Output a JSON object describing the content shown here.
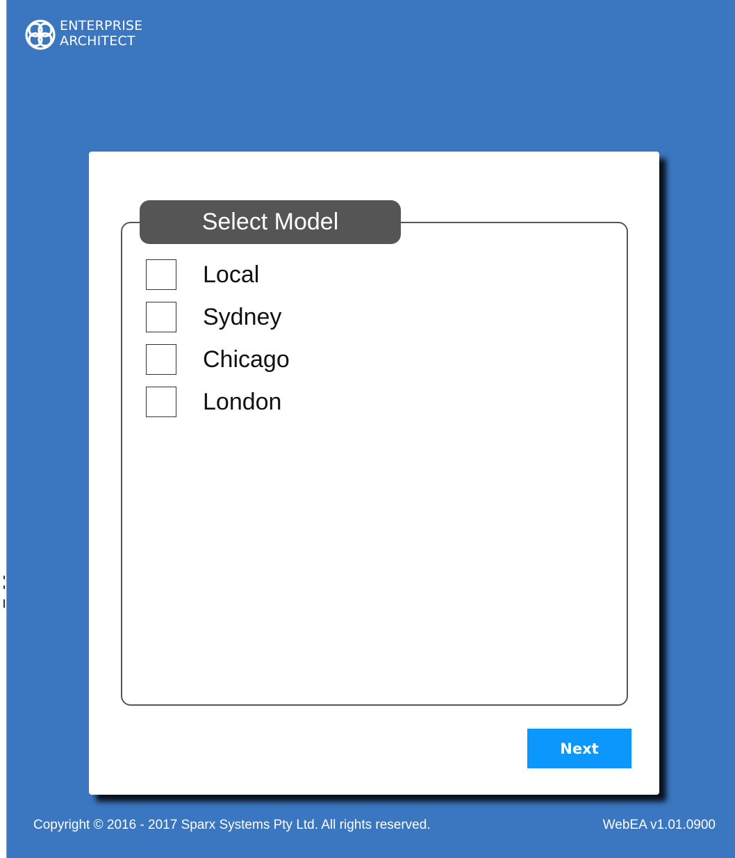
{
  "brand": {
    "line1": "ENTERPRISE",
    "line2": "ARCHITECT",
    "icon": "enterprise-architect-logo-icon"
  },
  "panel": {
    "legend": "Select Model",
    "models": [
      {
        "label": "Local",
        "checked": false
      },
      {
        "label": "Sydney",
        "checked": false
      },
      {
        "label": "Chicago",
        "checked": false
      },
      {
        "label": "London",
        "checked": false
      }
    ],
    "next_label": "Next"
  },
  "footer": {
    "copyright": "Copyright © 2016 - 2017 Sparx Systems Pty Ltd. All rights reserved.",
    "version": "WebEA v1.01.0900"
  },
  "colors": {
    "background": "#3a77c0",
    "legend_bg": "#555555",
    "next_button": "#0b97fb"
  }
}
